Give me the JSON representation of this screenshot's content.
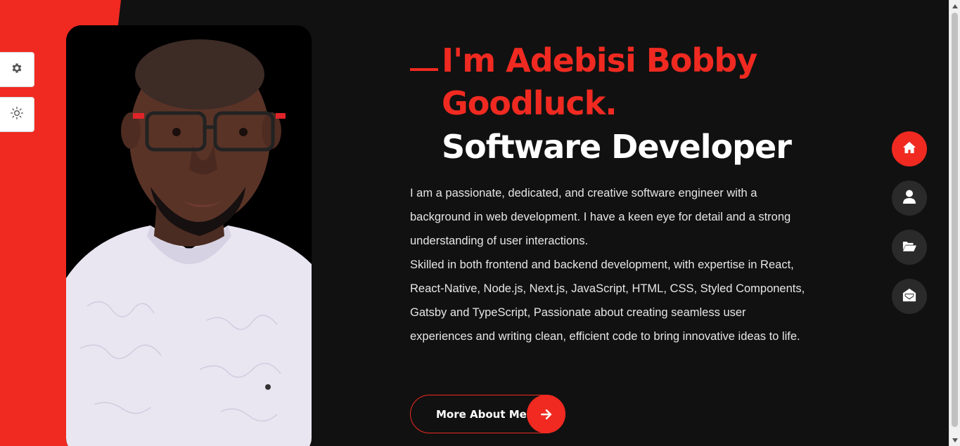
{
  "theme": {
    "accent": "#f02a21",
    "background": "#111111",
    "nav_inactive": "#2b2a2a"
  },
  "side_panel": {
    "settings_icon": "gear-icon",
    "theme_icon": "sun-icon"
  },
  "profile": {
    "photo": "portrait of Adebisi Bobby Goodluck wearing glasses and a white embroidered top"
  },
  "hero": {
    "name_line1": "I'm Adebisi Bobby",
    "name_line2": "Goodluck.",
    "role": "Software Developer",
    "bio_p1": "I am a passionate, dedicated, and creative software engineer with a background in web development. I have a keen eye for detail and a strong understanding of user interactions.",
    "bio_p2": "Skilled in both frontend and backend development, with expertise in React, React-Native, Node.js, Next.js, JavaScript, HTML, CSS, Styled Components, Gatsby and TypeScript, Passionate about creating seamless user experiences and writing clean, efficient code to bring innovative ideas to life.",
    "cta_label": "More About Me",
    "cta_icon": "arrow-right-icon"
  },
  "nav": {
    "items": [
      {
        "icon": "home-icon",
        "active": true
      },
      {
        "icon": "user-icon",
        "active": false
      },
      {
        "icon": "folder-open-icon",
        "active": false
      },
      {
        "icon": "envelope-open-icon",
        "active": false
      }
    ]
  }
}
